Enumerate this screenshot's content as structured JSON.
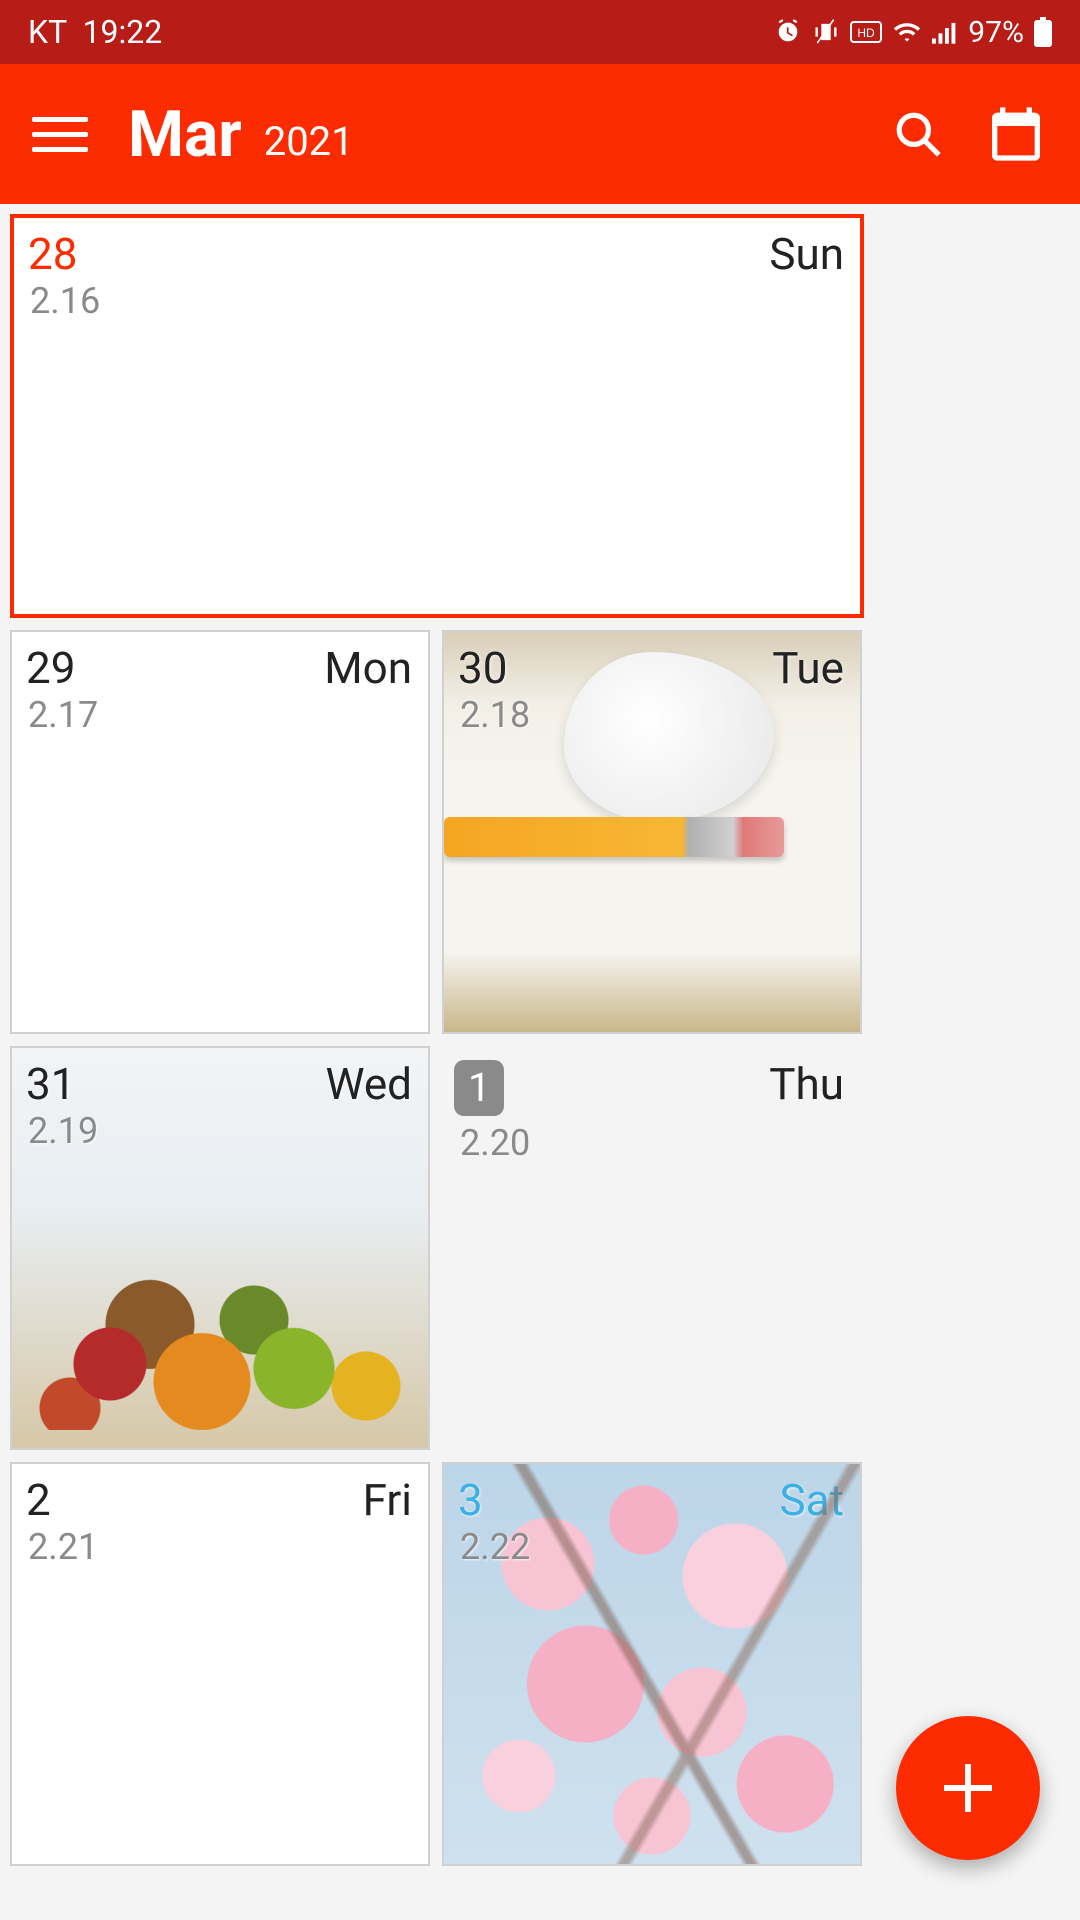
{
  "status": {
    "carrier": "KT",
    "time": "19:22",
    "battery": "97%"
  },
  "header": {
    "month": "Mar",
    "year": "2021",
    "today_badge": "1"
  },
  "days": [
    {
      "date": "28",
      "dow": "Sun",
      "sub": "2.16"
    },
    {
      "date": "29",
      "dow": "Mon",
      "sub": "2.17"
    },
    {
      "date": "30",
      "dow": "Tue",
      "sub": "2.18"
    },
    {
      "date": "31",
      "dow": "Wed",
      "sub": "2.19"
    },
    {
      "date": "1",
      "dow": "Thu",
      "sub": "2.20"
    },
    {
      "date": "2",
      "dow": "Fri",
      "sub": "2.21"
    },
    {
      "date": "3",
      "dow": "Sat",
      "sub": "2.22"
    }
  ]
}
